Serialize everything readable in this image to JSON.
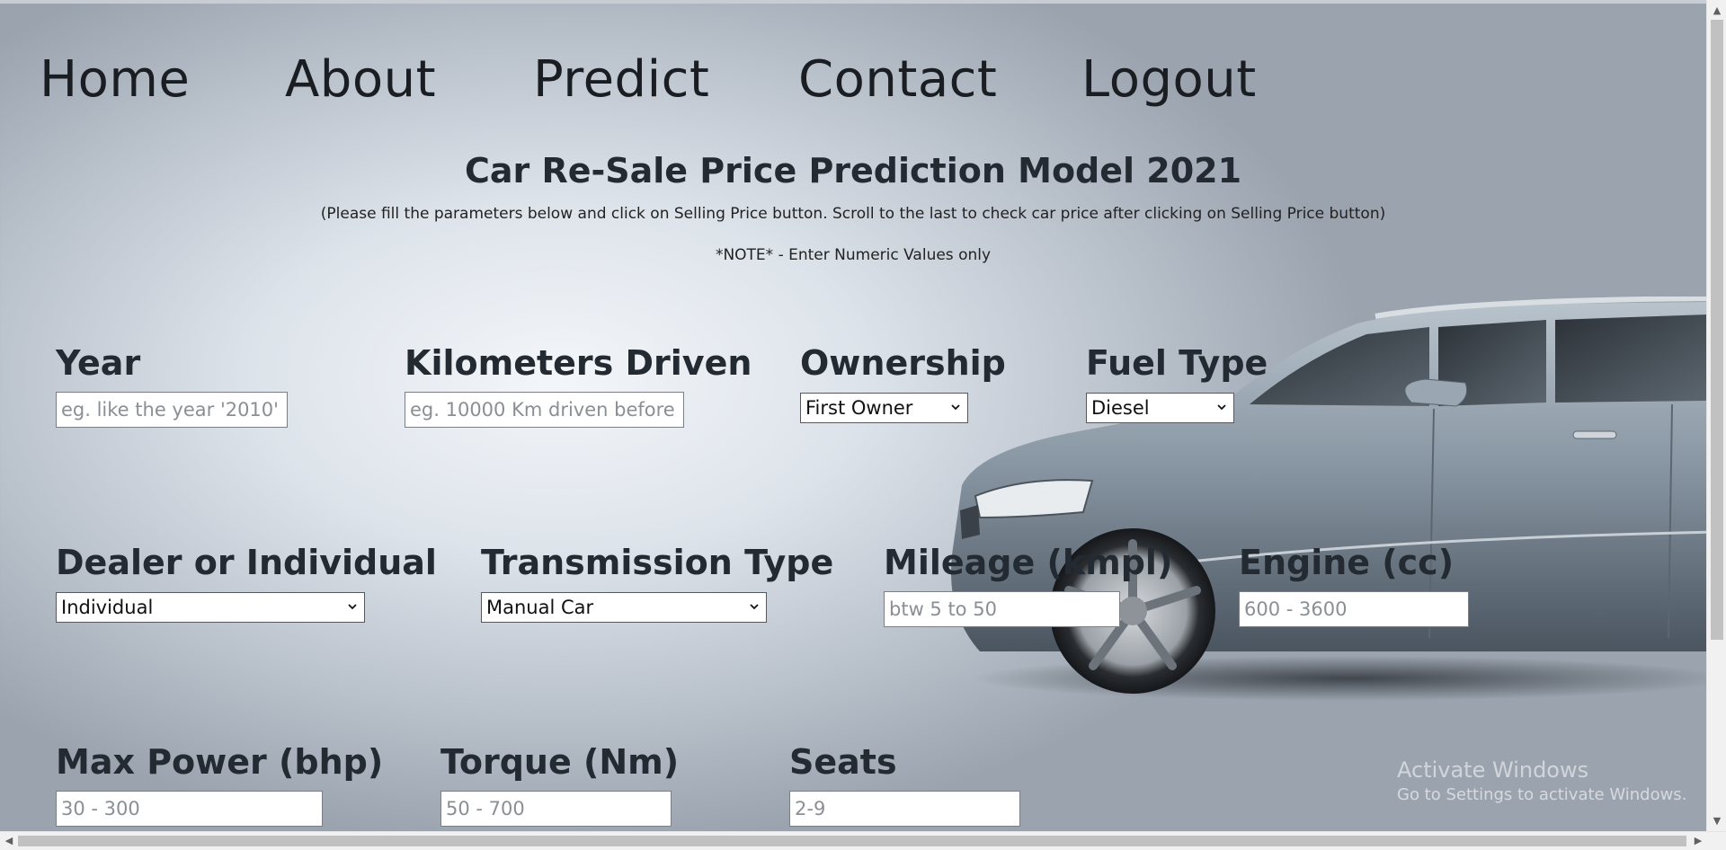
{
  "nav": {
    "items": [
      {
        "label": "Home"
      },
      {
        "label": "About"
      },
      {
        "label": "Predict"
      },
      {
        "label": "Contact"
      },
      {
        "label": "Logout"
      }
    ]
  },
  "header": {
    "title": "Car Re-Sale Price Prediction Model 2021",
    "subtitle": "(Please fill the parameters below and click on Selling Price button. Scroll to the last to check car price after clicking on Selling Price button)",
    "note": "*NOTE* - Enter Numeric Values only"
  },
  "form": {
    "year": {
      "label": "Year",
      "placeholder": "eg. like the year '2010'"
    },
    "km_driven": {
      "label": "Kilometers Driven",
      "placeholder": "eg. 10000 Km driven before"
    },
    "ownership": {
      "label": "Ownership",
      "value": "First Owner"
    },
    "fuel_type": {
      "label": "Fuel Type",
      "value": "Diesel"
    },
    "seller_type": {
      "label": "Dealer or Individual",
      "value": "Individual"
    },
    "transmission": {
      "label": "Transmission Type",
      "value": "Manual Car"
    },
    "mileage": {
      "label": "Mileage (kmpl)",
      "placeholder": "btw 5 to 50"
    },
    "engine": {
      "label": "Engine (cc)",
      "placeholder": "600 - 3600"
    },
    "max_power": {
      "label": "Max Power (bhp)",
      "placeholder": "30 - 300"
    },
    "torque": {
      "label": "Torque (Nm)",
      "placeholder": "50 - 700"
    },
    "seats": {
      "label": "Seats",
      "placeholder": "2-9"
    }
  },
  "windows_notice": {
    "title": "Activate Windows",
    "subtitle": "Go to Settings to activate Windows."
  }
}
